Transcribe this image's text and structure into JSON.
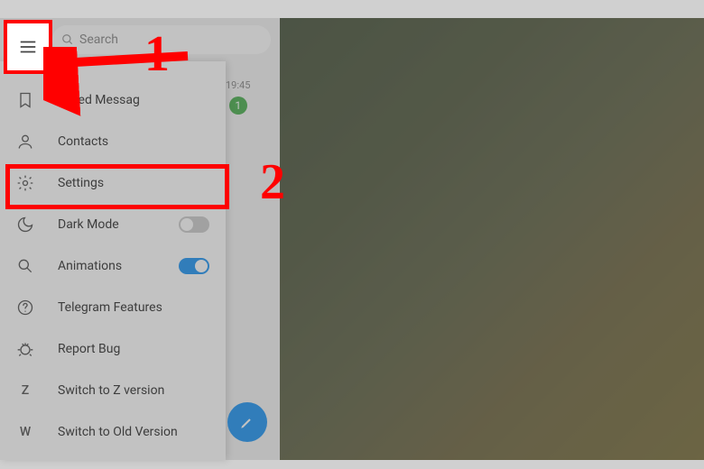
{
  "search": {
    "placeholder": "Search"
  },
  "chat_preview": {
    "time": "19:45",
    "unread": "1"
  },
  "menu": {
    "saved": "Saved Messag",
    "contacts": "Contacts",
    "settings": "Settings",
    "darkmode": "Dark Mode",
    "animations": "Animations",
    "features": "Telegram Features",
    "report": "Report Bug",
    "switch_z": "Switch to Z version",
    "switch_old": "Switch to Old Version",
    "letter_z": "Z",
    "letter_w": "W"
  },
  "toggles": {
    "darkmode": false,
    "animations": true
  },
  "annotations": {
    "step1": "1",
    "step2": "2"
  },
  "colors": {
    "accent": "#2196f3",
    "annotation": "#ff0000",
    "unread": "#4caf50"
  }
}
